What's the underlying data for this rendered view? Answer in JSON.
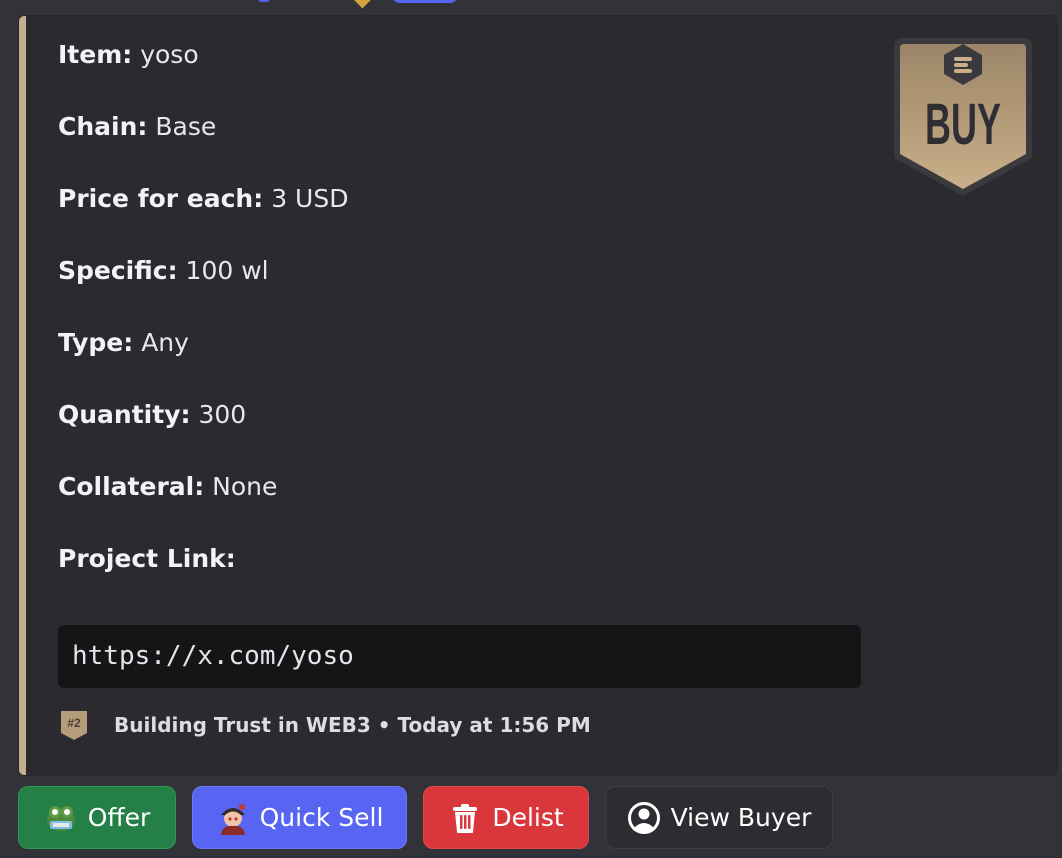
{
  "embed": {
    "accent_color": "#c6af8e",
    "thumbnail": {
      "icon": "buy-badge-icon",
      "label": "BUY",
      "logo_letter": "e"
    },
    "fields": [
      {
        "name": "Item:",
        "value": "yoso"
      },
      {
        "name": "Chain:",
        "value": "Base"
      },
      {
        "name": "Price for each:",
        "value": "3 USD"
      },
      {
        "name": "Specific:",
        "value": "100 wl"
      },
      {
        "name": "Type:",
        "value": "Any"
      },
      {
        "name": "Quantity:",
        "value": "300"
      },
      {
        "name": "Collateral:",
        "value": "None"
      },
      {
        "name": "Project Link:",
        "value": ""
      }
    ],
    "project_link": "https://x.com/yoso",
    "footer": {
      "icon": "exchange-badge-icon",
      "badge_text": "#2",
      "text": "Building Trust in WEB3 • Today at 1:56 PM"
    }
  },
  "actions": [
    {
      "label": "Offer",
      "icon": "frog-emoji-icon",
      "color": "#248046"
    },
    {
      "label": "Quick Sell",
      "icon": "character-emoji-icon",
      "color": "#5865f2"
    },
    {
      "label": "Delist",
      "icon": "trash-icon",
      "color": "#da373c"
    },
    {
      "label": "View Buyer",
      "icon": "user-circle-icon",
      "color": "#2b2d31"
    }
  ]
}
